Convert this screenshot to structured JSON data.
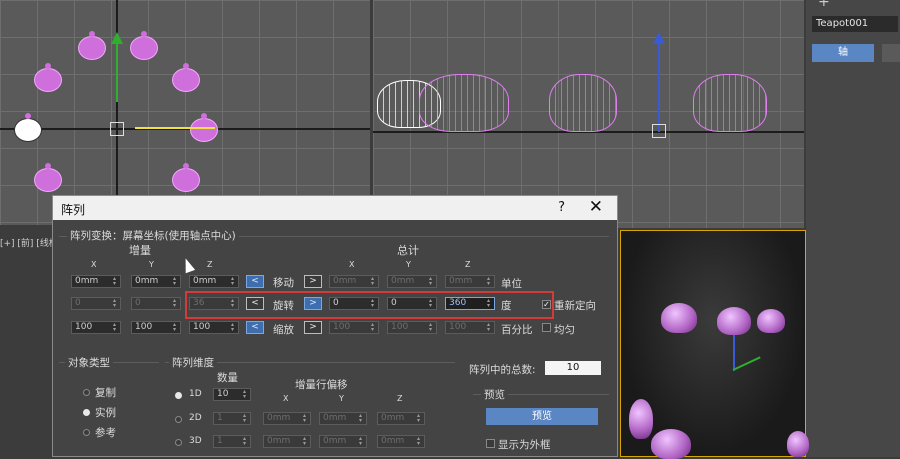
{
  "right_panel": {
    "object_name": "Teapot001",
    "axis_button": "轴"
  },
  "viewports": {
    "left_label": "[+] [前] [线框]"
  },
  "dialog": {
    "title": "阵列",
    "help": "?",
    "close": "✕",
    "section_label": "阵列变换：屏幕坐标(使用轴点中心)",
    "increment_header": "增量",
    "total_header": "总计",
    "axis_x": "X",
    "axis_y": "Y",
    "axis_z": "Z",
    "rows": [
      {
        "name": "移动",
        "unit": "单位",
        "inc": [
          "0mm",
          "0mm",
          "0mm"
        ],
        "total": [
          "0mm",
          "0mm",
          "0mm"
        ],
        "left_btn": "<",
        "right_btn": ">"
      },
      {
        "name": "旋转",
        "unit": "度",
        "inc": [
          "0",
          "0",
          "36"
        ],
        "total": [
          "0",
          "0",
          "360"
        ],
        "left_btn": "<",
        "right_btn": ">"
      },
      {
        "name": "缩放",
        "unit": "百分比",
        "inc": [
          "100",
          "100",
          "100"
        ],
        "total": [
          "100",
          "100",
          "100"
        ],
        "left_btn": "<",
        "right_btn": ">"
      }
    ],
    "reorient_label": "重新定向",
    "uniform_label": "均匀",
    "object_type": {
      "title": "对象类型",
      "options": [
        "复制",
        "实例",
        "参考"
      ],
      "selected": "实例"
    },
    "array_dims": {
      "title": "阵列维度",
      "count_header": "数量",
      "row_offset_header": "增量行偏移",
      "dims": [
        {
          "name": "1D",
          "count": "10"
        },
        {
          "name": "2D",
          "count": "1",
          "x": "0mm",
          "y": "0mm",
          "z": "0mm"
        },
        {
          "name": "3D",
          "count": "1",
          "x": "0mm",
          "y": "0mm",
          "z": "0mm"
        }
      ]
    },
    "total_in_array_label": "阵列中的总数:",
    "total_in_array": "10",
    "preview_title": "预览",
    "preview_button": "预览",
    "show_as_box_label": "显示为外框"
  }
}
